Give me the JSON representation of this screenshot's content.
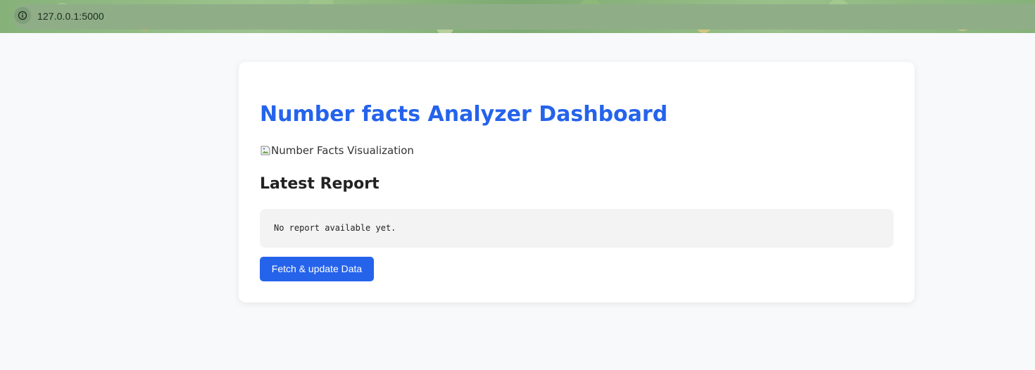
{
  "browser": {
    "url": "127.0.0.1:5000",
    "site_info_icon": "info-icon"
  },
  "dashboard": {
    "title": "Number facts Analyzer Dashboard",
    "image_alt": "Number Facts Visualization",
    "report_heading": "Latest Report",
    "report_text": "No report available yet.",
    "fetch_button_label": "Fetch & update Data"
  },
  "colors": {
    "accent": "#2563eb",
    "page_background": "#f8f9fb",
    "card_background": "#ffffff",
    "report_background": "#f3f3f3"
  }
}
